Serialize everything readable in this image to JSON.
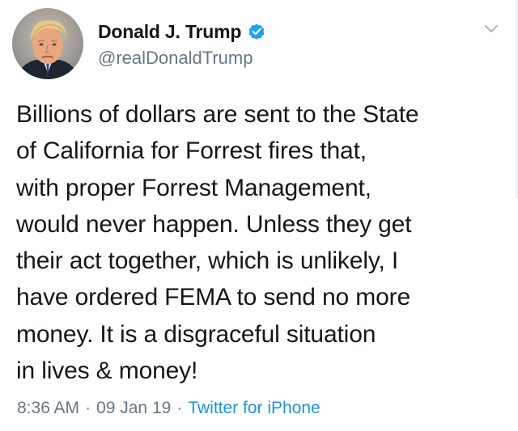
{
  "tweet": {
    "display_name": "Donald J. Trump",
    "handle": "@realDonaldTrump",
    "verified_icon": "verified-badge-icon",
    "menu_icon": "chevron-down-icon",
    "text_lines": [
      "Billions of dollars are sent to the State",
      "of California for Forrest fires that,",
      "with proper Forrest Management,",
      "would never happen. Unless they get",
      "their act together, which is unlikely, I",
      "have ordered FEMA to send no more",
      "money. It is a disgraceful situation",
      "in lives & money!"
    ],
    "time": "8:36 AM",
    "separator": "·",
    "date": "09 Jan 19",
    "source": "Twitter for iPhone"
  },
  "colors": {
    "text": "#14171a",
    "secondary": "#657786",
    "link": "#1b95e0",
    "verified": "#1da1f2"
  }
}
